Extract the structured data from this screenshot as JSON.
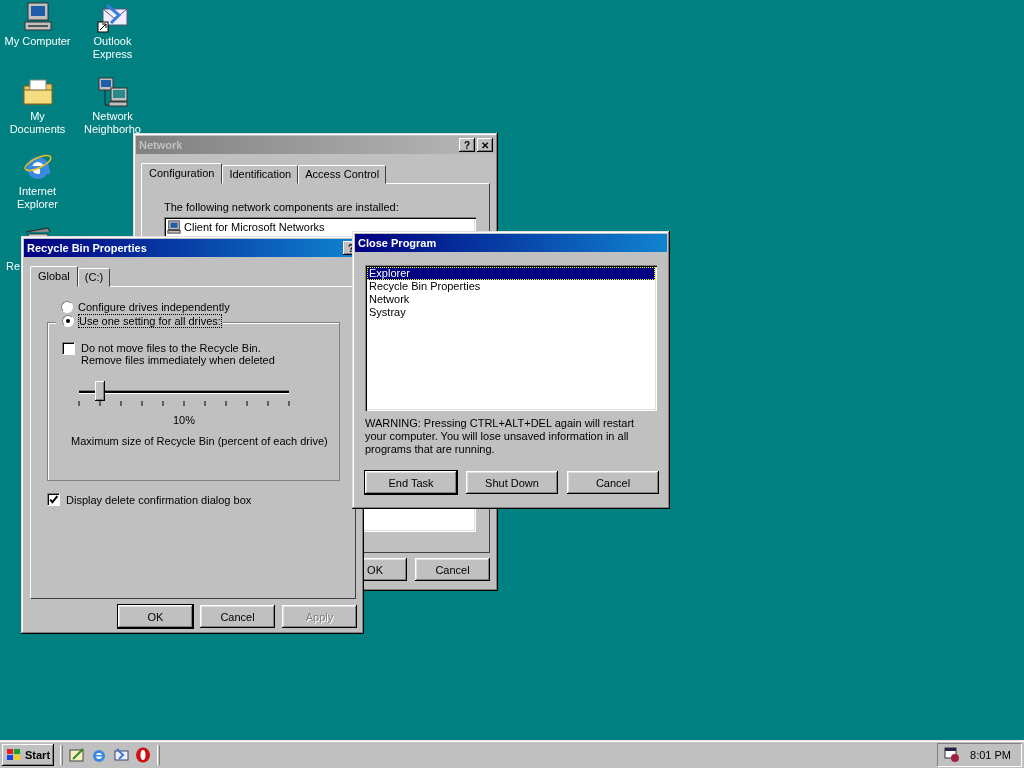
{
  "desktop": {
    "icons": [
      {
        "label": "My Computer",
        "kind": "computer"
      },
      {
        "label": "Outlook Express",
        "kind": "mail"
      },
      {
        "label": "My Documents",
        "kind": "documents"
      },
      {
        "label": "Network Neighborho",
        "kind": "network"
      },
      {
        "label": "Internet Explorer",
        "kind": "browser"
      },
      {
        "label": "Re",
        "kind": "recycle"
      }
    ]
  },
  "network_window": {
    "title": "Network",
    "active": false,
    "help": "?",
    "close": "✕",
    "tabs": [
      {
        "label": "Configuration",
        "selected": true
      },
      {
        "label": "Identification",
        "selected": false
      },
      {
        "label": "Access Control",
        "selected": false
      }
    ],
    "components_label": "The following network components are installed:",
    "components": [
      "Client for Microsoft Networks"
    ],
    "buttons": [
      "OK",
      "Cancel"
    ]
  },
  "recycle_bin_window": {
    "title": "Recycle Bin Properties",
    "active": true,
    "help": "?",
    "tabs": [
      {
        "label": "Global",
        "selected": true
      },
      {
        "label": "(C:)",
        "selected": false
      }
    ],
    "radios": [
      {
        "label": "Configure drives independently",
        "selected": false
      },
      {
        "label": "Use one setting for all drives:",
        "selected": true
      }
    ],
    "no_recycle": {
      "label": "Do not move files to the Recycle Bin.",
      "sublabel": "Remove files immediately when deleted",
      "checked": false
    },
    "slider": {
      "level": 0.1,
      "reading": "10%",
      "label": "Maximum size of Recycle Bin (percent of each drive)"
    },
    "confirm": {
      "label": "Display delete confirmation dialog box",
      "checked": true
    },
    "buttons": [
      {
        "label": "OK",
        "disabled": false
      },
      {
        "label": "Cancel",
        "disabled": false
      },
      {
        "label": "Apply",
        "disabled": true
      }
    ]
  },
  "close_program_window": {
    "title": "Close Program",
    "active": true,
    "programs": [
      {
        "label": "Explorer",
        "selected": true
      },
      {
        "label": "Recycle Bin Properties",
        "selected": false
      },
      {
        "label": "Network",
        "selected": false
      },
      {
        "label": "Systray",
        "selected": false
      }
    ],
    "warning": "WARNING: Pressing CTRL+ALT+DEL again will restart your computer. You will lose unsaved information in all programs that are running.",
    "buttons": [
      "End Task",
      "Shut Down",
      "Cancel"
    ]
  },
  "taskbar": {
    "start": "Start",
    "quick_launch": [
      {
        "kind": "desktop"
      },
      {
        "kind": "browser"
      },
      {
        "kind": "mail"
      },
      {
        "kind": "opera"
      }
    ],
    "clock": "8:01 PM"
  }
}
